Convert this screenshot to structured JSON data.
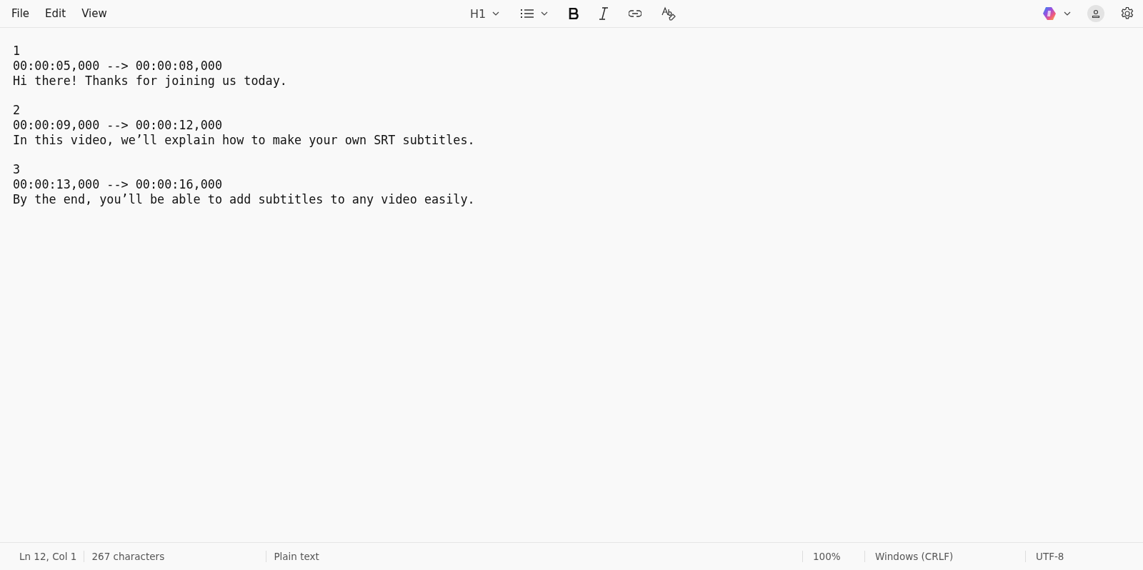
{
  "menu": [
    "File",
    "Edit",
    "View"
  ],
  "toolbar": {
    "heading": "H1"
  },
  "document": [
    {
      "index": "1",
      "timing": "00:00:05,000 --> 00:00:08,000",
      "text": "Hi there! Thanks for joining us today."
    },
    {
      "index": "2",
      "timing": "00:00:09,000 --> 00:00:12,000",
      "text": "In this video, we’ll explain how to make your own SRT subtitles."
    },
    {
      "index": "3",
      "timing": "00:00:13,000 --> 00:00:16,000",
      "text": "By the end, you’ll be able to add subtitles to any video easily."
    }
  ],
  "status_bar": {
    "position": "Ln 12, Col 1",
    "characters": "267 characters",
    "format": "Plain text",
    "zoom": "100%",
    "line_ending": "Windows (CRLF)",
    "encoding": "UTF-8"
  }
}
